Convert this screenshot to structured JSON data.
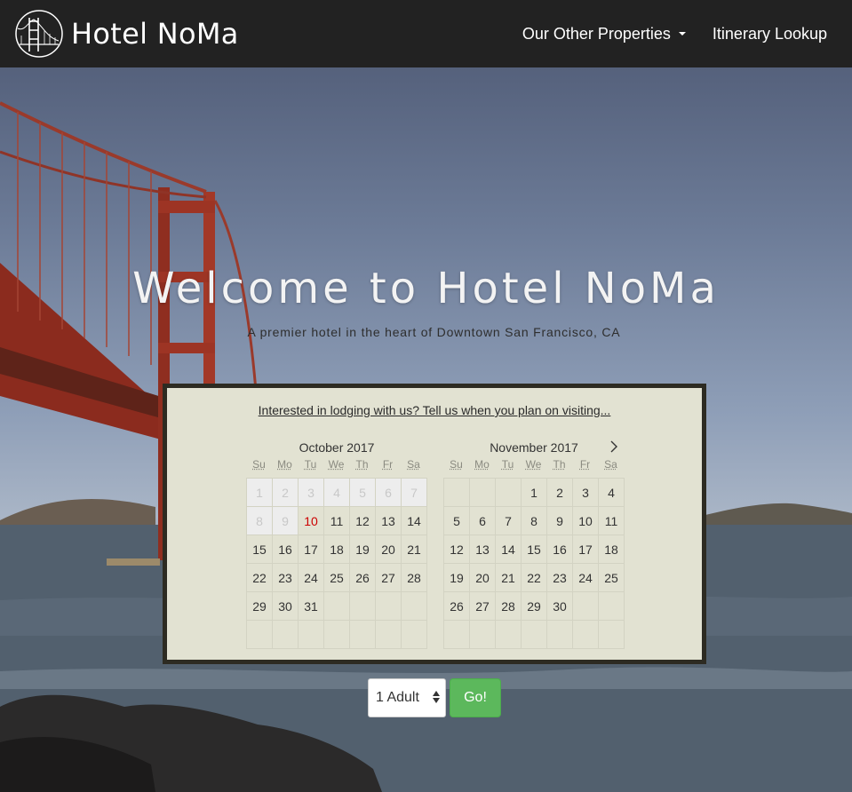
{
  "brand": {
    "name": "Hotel NoMa",
    "logo_icon": "bridge-logo-icon"
  },
  "nav": [
    {
      "label": "Our Other Properties",
      "has_caret": true
    },
    {
      "label": "Itinerary Lookup"
    }
  ],
  "hero": {
    "title": "Welcome to Hotel NoMa",
    "subtitle": "A premier hotel in the heart of Downtown San Francisco, CA"
  },
  "booking": {
    "prompt": "Interested in lodging with us? Tell us when you plan on visiting...",
    "weekdays": [
      "Su",
      "Mo",
      "Tu",
      "We",
      "Th",
      "Fr",
      "Sa"
    ],
    "next_icon": "chevron-right-icon",
    "months": [
      {
        "title": "October 2017",
        "days": [
          {
            "d": "1",
            "s": "past"
          },
          {
            "d": "2",
            "s": "past"
          },
          {
            "d": "3",
            "s": "past"
          },
          {
            "d": "4",
            "s": "past"
          },
          {
            "d": "5",
            "s": "past"
          },
          {
            "d": "6",
            "s": "past"
          },
          {
            "d": "7",
            "s": "past"
          },
          {
            "d": "8",
            "s": "past"
          },
          {
            "d": "9",
            "s": "past"
          },
          {
            "d": "10",
            "s": "today"
          },
          {
            "d": "11",
            "s": ""
          },
          {
            "d": "12",
            "s": ""
          },
          {
            "d": "13",
            "s": ""
          },
          {
            "d": "14",
            "s": ""
          },
          {
            "d": "15",
            "s": ""
          },
          {
            "d": "16",
            "s": ""
          },
          {
            "d": "17",
            "s": ""
          },
          {
            "d": "18",
            "s": ""
          },
          {
            "d": "19",
            "s": ""
          },
          {
            "d": "20",
            "s": ""
          },
          {
            "d": "21",
            "s": ""
          },
          {
            "d": "22",
            "s": ""
          },
          {
            "d": "23",
            "s": ""
          },
          {
            "d": "24",
            "s": ""
          },
          {
            "d": "25",
            "s": ""
          },
          {
            "d": "26",
            "s": ""
          },
          {
            "d": "27",
            "s": ""
          },
          {
            "d": "28",
            "s": ""
          },
          {
            "d": "29",
            "s": ""
          },
          {
            "d": "30",
            "s": ""
          },
          {
            "d": "31",
            "s": ""
          },
          {
            "d": "",
            "s": "filler"
          },
          {
            "d": "",
            "s": "filler"
          },
          {
            "d": "",
            "s": "filler"
          },
          {
            "d": "",
            "s": "filler"
          },
          {
            "d": "",
            "s": "filler"
          },
          {
            "d": "",
            "s": "filler"
          },
          {
            "d": "",
            "s": "filler"
          },
          {
            "d": "",
            "s": "filler"
          },
          {
            "d": "",
            "s": "filler"
          },
          {
            "d": "",
            "s": "filler"
          },
          {
            "d": "",
            "s": "filler"
          }
        ]
      },
      {
        "title": "November 2017",
        "days": [
          {
            "d": "",
            "s": "filler"
          },
          {
            "d": "",
            "s": "filler"
          },
          {
            "d": "",
            "s": "filler"
          },
          {
            "d": "1",
            "s": ""
          },
          {
            "d": "2",
            "s": ""
          },
          {
            "d": "3",
            "s": ""
          },
          {
            "d": "4",
            "s": ""
          },
          {
            "d": "5",
            "s": ""
          },
          {
            "d": "6",
            "s": ""
          },
          {
            "d": "7",
            "s": ""
          },
          {
            "d": "8",
            "s": ""
          },
          {
            "d": "9",
            "s": ""
          },
          {
            "d": "10",
            "s": ""
          },
          {
            "d": "11",
            "s": ""
          },
          {
            "d": "12",
            "s": ""
          },
          {
            "d": "13",
            "s": ""
          },
          {
            "d": "14",
            "s": ""
          },
          {
            "d": "15",
            "s": ""
          },
          {
            "d": "16",
            "s": ""
          },
          {
            "d": "17",
            "s": ""
          },
          {
            "d": "18",
            "s": ""
          },
          {
            "d": "19",
            "s": ""
          },
          {
            "d": "20",
            "s": ""
          },
          {
            "d": "21",
            "s": ""
          },
          {
            "d": "22",
            "s": ""
          },
          {
            "d": "23",
            "s": ""
          },
          {
            "d": "24",
            "s": ""
          },
          {
            "d": "25",
            "s": ""
          },
          {
            "d": "26",
            "s": ""
          },
          {
            "d": "27",
            "s": ""
          },
          {
            "d": "28",
            "s": ""
          },
          {
            "d": "29",
            "s": ""
          },
          {
            "d": "30",
            "s": ""
          },
          {
            "d": "",
            "s": "filler"
          },
          {
            "d": "",
            "s": "filler"
          },
          {
            "d": "",
            "s": "filler"
          },
          {
            "d": "",
            "s": "filler"
          },
          {
            "d": "",
            "s": "filler"
          },
          {
            "d": "",
            "s": "filler"
          },
          {
            "d": "",
            "s": "filler"
          },
          {
            "d": "",
            "s": "filler"
          },
          {
            "d": "",
            "s": "filler"
          }
        ]
      }
    ]
  },
  "guests": {
    "selected": "1 Adult"
  },
  "go_button": {
    "label": "Go!"
  },
  "colors": {
    "navbar": "#222222",
    "panel": "#e2e2d2",
    "panel_border": "#2d2b22",
    "today": "#cc0000",
    "go": "#5cb85c"
  }
}
